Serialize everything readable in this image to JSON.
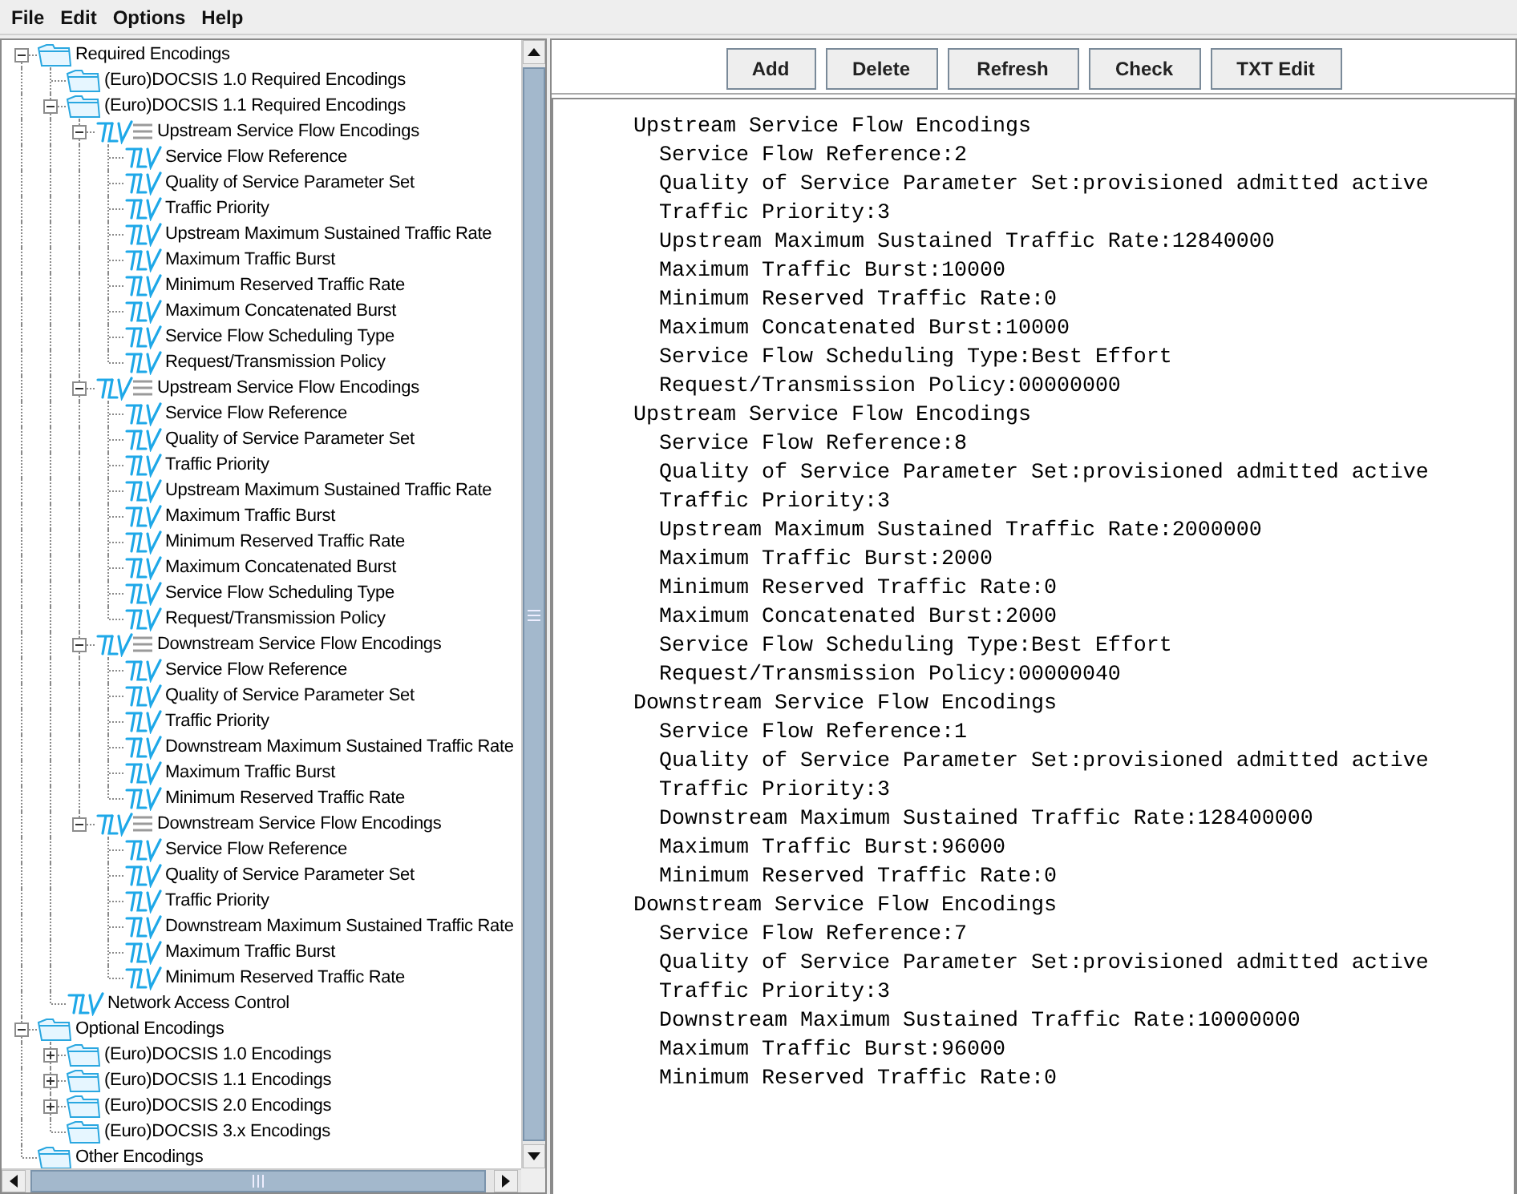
{
  "menu": [
    "File",
    "Edit",
    "Options",
    "Help"
  ],
  "tree": [
    {
      "label": "Required Encodings",
      "kind": "folder",
      "expanded": true,
      "children": [
        {
          "label": "(Euro)DOCSIS 1.0 Required Encodings",
          "kind": "folder"
        },
        {
          "label": "(Euro)DOCSIS 1.1 Required Encodings",
          "kind": "folder",
          "expanded": true,
          "children": [
            {
              "label": "Upstream Service Flow Encodings",
              "kind": "tlv-group",
              "expanded": true,
              "children": [
                {
                  "label": "Service Flow Reference",
                  "kind": "tlv"
                },
                {
                  "label": "Quality of Service Parameter Set",
                  "kind": "tlv"
                },
                {
                  "label": "Traffic Priority",
                  "kind": "tlv"
                },
                {
                  "label": "Upstream Maximum Sustained Traffic Rate",
                  "kind": "tlv"
                },
                {
                  "label": "Maximum Traffic Burst",
                  "kind": "tlv"
                },
                {
                  "label": "Minimum Reserved Traffic Rate",
                  "kind": "tlv"
                },
                {
                  "label": "Maximum Concatenated Burst",
                  "kind": "tlv"
                },
                {
                  "label": "Service Flow Scheduling Type",
                  "kind": "tlv"
                },
                {
                  "label": "Request/Transmission Policy",
                  "kind": "tlv"
                }
              ]
            },
            {
              "label": "Upstream Service Flow Encodings",
              "kind": "tlv-group",
              "expanded": true,
              "children": [
                {
                  "label": "Service Flow Reference",
                  "kind": "tlv"
                },
                {
                  "label": "Quality of Service Parameter Set",
                  "kind": "tlv"
                },
                {
                  "label": "Traffic Priority",
                  "kind": "tlv"
                },
                {
                  "label": "Upstream Maximum Sustained Traffic Rate",
                  "kind": "tlv"
                },
                {
                  "label": "Maximum Traffic Burst",
                  "kind": "tlv"
                },
                {
                  "label": "Minimum Reserved Traffic Rate",
                  "kind": "tlv"
                },
                {
                  "label": "Maximum Concatenated Burst",
                  "kind": "tlv"
                },
                {
                  "label": "Service Flow Scheduling Type",
                  "kind": "tlv"
                },
                {
                  "label": "Request/Transmission Policy",
                  "kind": "tlv"
                }
              ]
            },
            {
              "label": "Downstream Service Flow Encodings",
              "kind": "tlv-group",
              "expanded": true,
              "children": [
                {
                  "label": "Service Flow Reference",
                  "kind": "tlv"
                },
                {
                  "label": "Quality of Service Parameter Set",
                  "kind": "tlv"
                },
                {
                  "label": "Traffic Priority",
                  "kind": "tlv"
                },
                {
                  "label": "Downstream Maximum Sustained Traffic Rate",
                  "kind": "tlv"
                },
                {
                  "label": "Maximum Traffic Burst",
                  "kind": "tlv"
                },
                {
                  "label": "Minimum Reserved Traffic Rate",
                  "kind": "tlv"
                }
              ]
            },
            {
              "label": "Downstream Service Flow Encodings",
              "kind": "tlv-group",
              "expanded": true,
              "children": [
                {
                  "label": "Service Flow Reference",
                  "kind": "tlv"
                },
                {
                  "label": "Quality of Service Parameter Set",
                  "kind": "tlv"
                },
                {
                  "label": "Traffic Priority",
                  "kind": "tlv"
                },
                {
                  "label": "Downstream Maximum Sustained Traffic Rate",
                  "kind": "tlv"
                },
                {
                  "label": "Maximum Traffic Burst",
                  "kind": "tlv"
                },
                {
                  "label": "Minimum Reserved Traffic Rate",
                  "kind": "tlv"
                }
              ]
            }
          ]
        },
        {
          "label": "Network Access Control",
          "kind": "tlv"
        }
      ]
    },
    {
      "label": "Optional Encodings",
      "kind": "folder",
      "expanded": true,
      "children": [
        {
          "label": "(Euro)DOCSIS 1.0 Encodings",
          "kind": "folder",
          "expanded": false
        },
        {
          "label": "(Euro)DOCSIS 1.1 Encodings",
          "kind": "folder",
          "expanded": false
        },
        {
          "label": "(Euro)DOCSIS 2.0 Encodings",
          "kind": "folder",
          "expanded": false
        },
        {
          "label": "(Euro)DOCSIS 3.x Encodings",
          "kind": "folder"
        }
      ]
    },
    {
      "label": "Other Encodings",
      "kind": "folder"
    }
  ],
  "buttons": [
    "Add",
    "Delete",
    "Refresh",
    "Check",
    "TXT Edit"
  ],
  "sections": [
    {
      "title": "Upstream Service Flow Encodings",
      "fields": [
        "Service Flow Reference:2",
        "Quality of Service Parameter Set:provisioned admitted active",
        "Traffic Priority:3",
        "Upstream Maximum Sustained Traffic Rate:12840000",
        "Maximum Traffic Burst:10000",
        "Minimum Reserved Traffic Rate:0",
        "Maximum Concatenated Burst:10000",
        "Service Flow Scheduling Type:Best Effort",
        "Request/Transmission Policy:00000000"
      ]
    },
    {
      "title": "Upstream Service Flow Encodings",
      "fields": [
        "Service Flow Reference:8",
        "Quality of Service Parameter Set:provisioned admitted active",
        "Traffic Priority:3",
        "Upstream Maximum Sustained Traffic Rate:2000000",
        "Maximum Traffic Burst:2000",
        "Minimum Reserved Traffic Rate:0",
        "Maximum Concatenated Burst:2000",
        "Service Flow Scheduling Type:Best Effort",
        "Request/Transmission Policy:00000040"
      ]
    },
    {
      "title": "Downstream Service Flow Encodings",
      "fields": [
        "Service Flow Reference:1",
        "Quality of Service Parameter Set:provisioned admitted active",
        "Traffic Priority:3",
        "Downstream Maximum Sustained Traffic Rate:128400000",
        "Maximum Traffic Burst:96000",
        "Minimum Reserved Traffic Rate:0"
      ]
    },
    {
      "title": "Downstream Service Flow Encodings",
      "fields": [
        "Service Flow Reference:7",
        "Quality of Service Parameter Set:provisioned admitted active",
        "Traffic Priority:3",
        "Downstream Maximum Sustained Traffic Rate:10000000",
        "Maximum Traffic Burst:96000",
        "Minimum Reserved Traffic Rate:0"
      ]
    }
  ]
}
